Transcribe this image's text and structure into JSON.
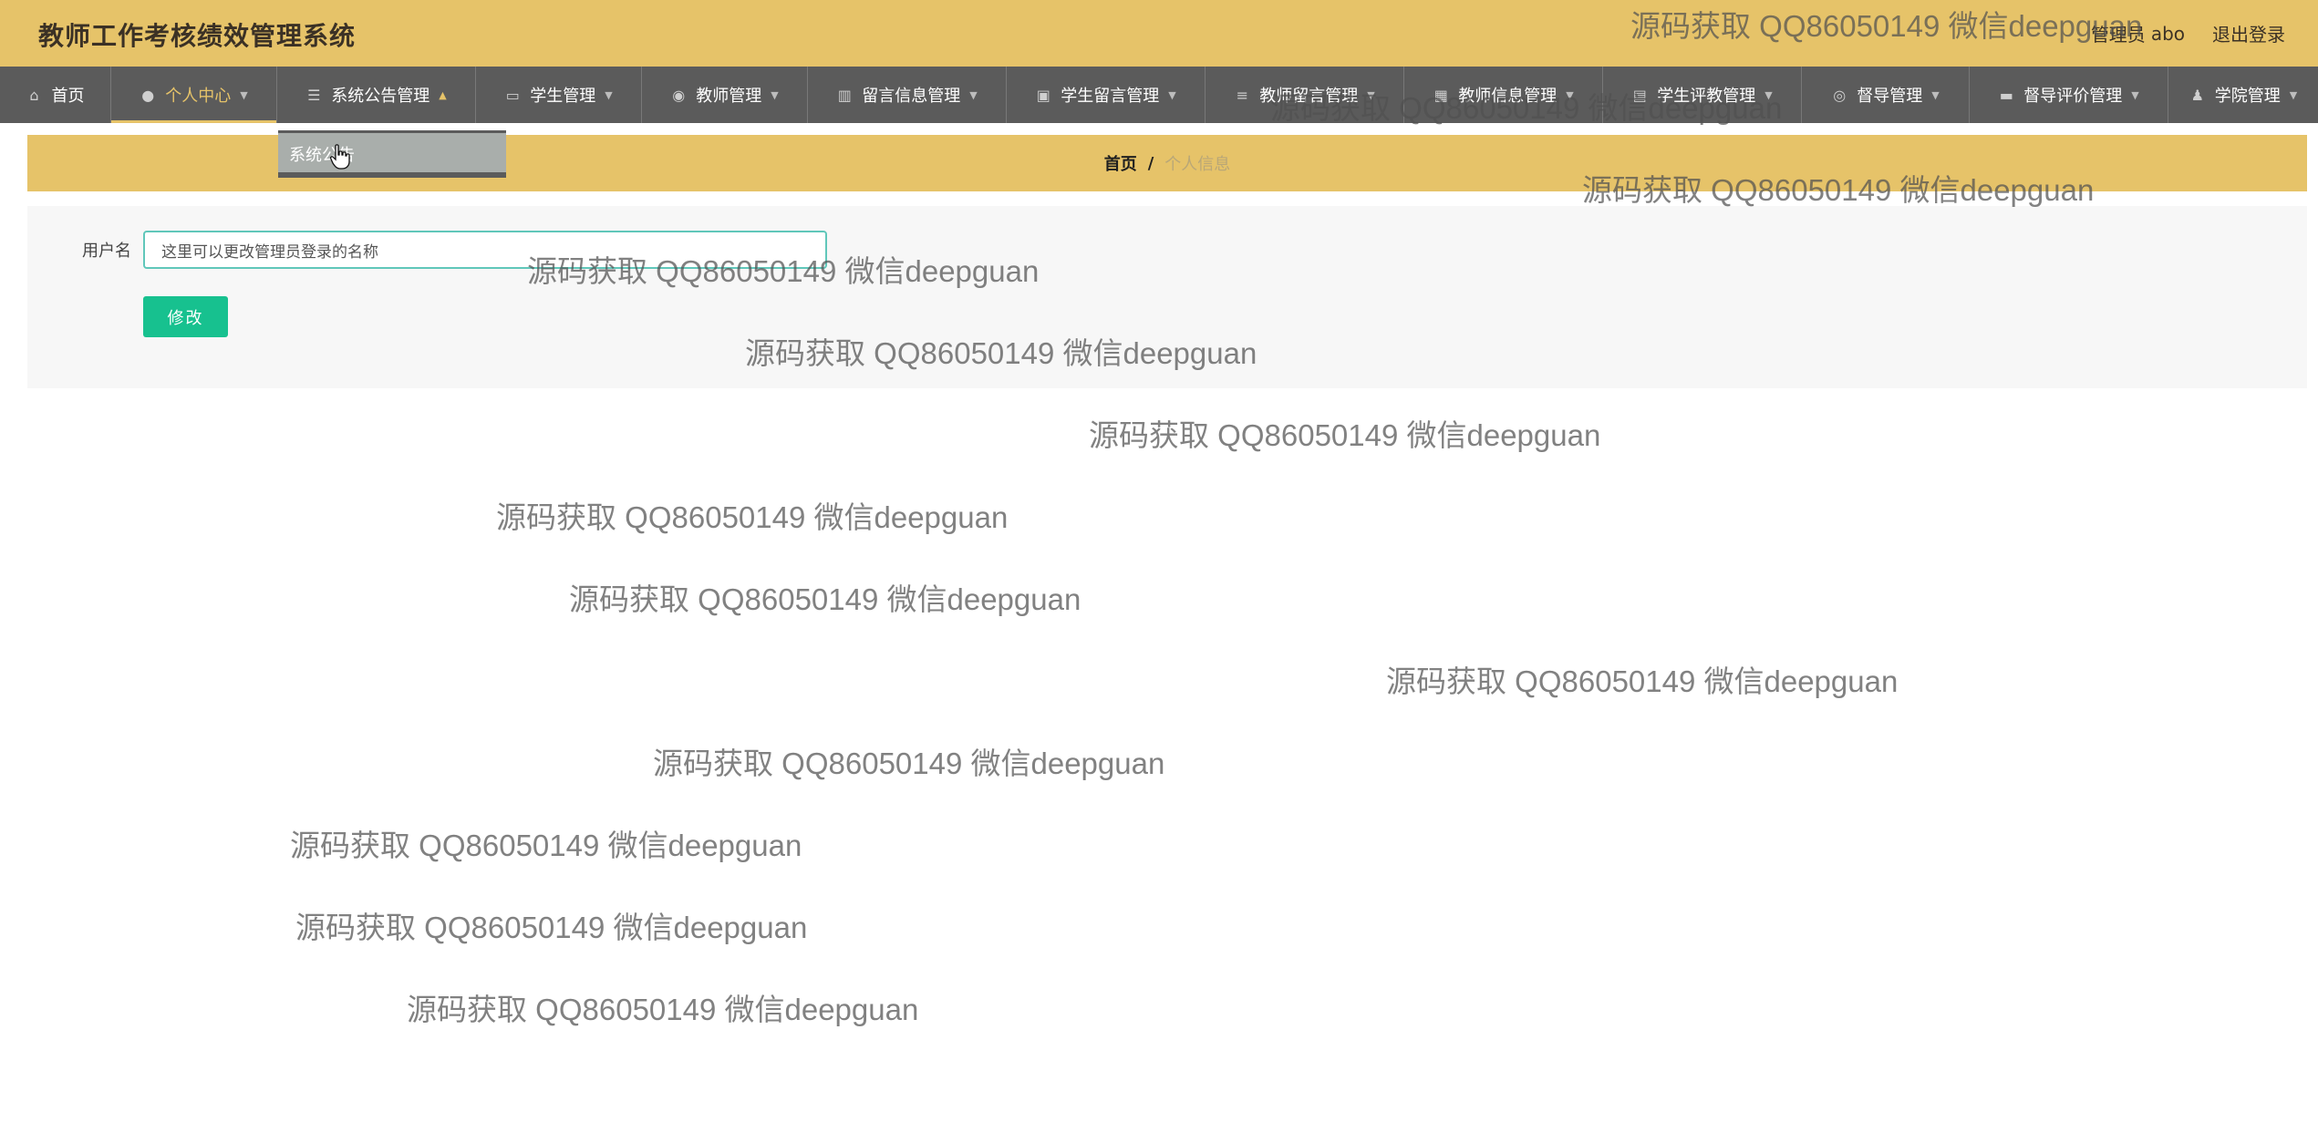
{
  "header": {
    "title": "教师工作考核绩效管理系统",
    "role_label": "管理员",
    "username": "abo",
    "logout_label": "退出登录"
  },
  "nav": {
    "items": [
      {
        "label": "首页",
        "icon": "home-icon"
      },
      {
        "label": "个人中心",
        "icon": "user-icon"
      },
      {
        "label": "系统公告管理",
        "icon": "sliders-icon"
      },
      {
        "label": "学生管理",
        "icon": "chat-icon"
      },
      {
        "label": "教师管理",
        "icon": "location-pin-icon"
      },
      {
        "label": "留言信息管理",
        "icon": "bar-chart-icon"
      },
      {
        "label": "学生留言管理",
        "icon": "clipboard-icon"
      },
      {
        "label": "教师留言管理",
        "icon": "list-icon"
      },
      {
        "label": "教师信息管理",
        "icon": "grid-icon"
      },
      {
        "label": "学生评教管理",
        "icon": "document-icon"
      },
      {
        "label": "督导管理",
        "icon": "target-icon"
      },
      {
        "label": "督导评价管理",
        "icon": "wallet-icon"
      },
      {
        "label": "学院管理",
        "icon": "person-icon"
      }
    ],
    "active_index": 1,
    "open_index": 2,
    "dropdown": {
      "items": [
        "系统公告"
      ]
    }
  },
  "breadcrumb": {
    "home": "首页",
    "separator": "/",
    "current": "个人信息"
  },
  "form": {
    "username_label": "用户名",
    "username_value": "这里可以更改管理员登录的名称",
    "submit_label": "修改"
  },
  "watermark": {
    "text": "源码获取 QQ86050149 微信deepguan"
  },
  "colors": {
    "header_bg": "#e6c369",
    "nav_bg": "#5b5b5b",
    "accent": "#e6c369",
    "button_bg": "#17c18f",
    "input_border": "#60c7ba"
  }
}
